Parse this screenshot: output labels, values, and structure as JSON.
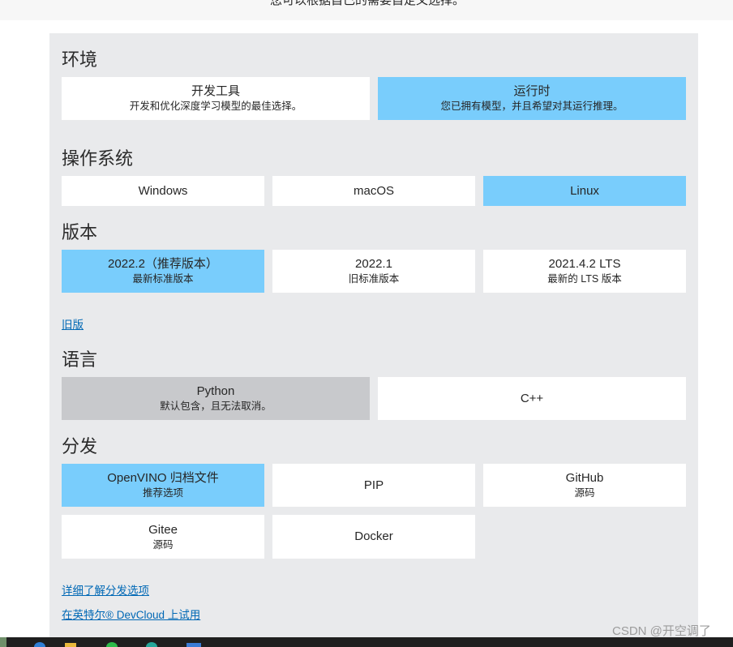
{
  "intro_text": "您可以根据自己的需要自定义选择。",
  "colors": {
    "selected": "#79cdfc",
    "panel": "#e9eaec",
    "disabled": "#c8c9cc",
    "link": "#0068b5",
    "taskbar": "#1f1f1f"
  },
  "environment": {
    "title": "环境",
    "options": [
      {
        "label": "开发工具",
        "sublabel": "开发和优化深度学习模型的最佳选择。",
        "selected": false
      },
      {
        "label": "运行时",
        "sublabel": "您已拥有模型，并且希望对其运行推理。",
        "selected": true
      }
    ]
  },
  "os": {
    "title": "操作系统",
    "options": [
      {
        "label": "Windows",
        "selected": false
      },
      {
        "label": "macOS",
        "selected": false
      },
      {
        "label": "Linux",
        "selected": true
      }
    ]
  },
  "version": {
    "title": "版本",
    "options": [
      {
        "label": "2022.2（推荐版本）",
        "sublabel": "最新标准版本",
        "selected": true
      },
      {
        "label": "2022.1",
        "sublabel": "旧标准版本",
        "selected": false
      },
      {
        "label": "2021.4.2 LTS",
        "sublabel": "最新的 LTS 版本",
        "selected": false
      }
    ],
    "legacy_link": "旧版"
  },
  "language": {
    "title": "语言",
    "options": [
      {
        "label": "Python",
        "sublabel": "默认包含，且无法取消。",
        "selected": false,
        "disabled": true
      },
      {
        "label": "C++",
        "selected": false,
        "disabled": false
      }
    ]
  },
  "distribution": {
    "title": "分发",
    "options": [
      {
        "label": "OpenVINO 归档文件",
        "sublabel": "推荐选项",
        "selected": true
      },
      {
        "label": "PIP",
        "selected": false
      },
      {
        "label": "GitHub",
        "sublabel": "源码",
        "selected": false
      },
      {
        "label": "Gitee",
        "sublabel": "源码",
        "selected": false
      },
      {
        "label": "Docker",
        "selected": false
      }
    ]
  },
  "links": {
    "distribution_details": "详细了解分发选项",
    "devcloud": "在英特尔® DevCloud 上试用"
  },
  "watermark": "CSDN @开空调了",
  "taskbar": {
    "icons": [
      "start-icon",
      "browser-icon",
      "folder-icon",
      "wechat-icon",
      "chrome-icon",
      "app-icon"
    ]
  }
}
